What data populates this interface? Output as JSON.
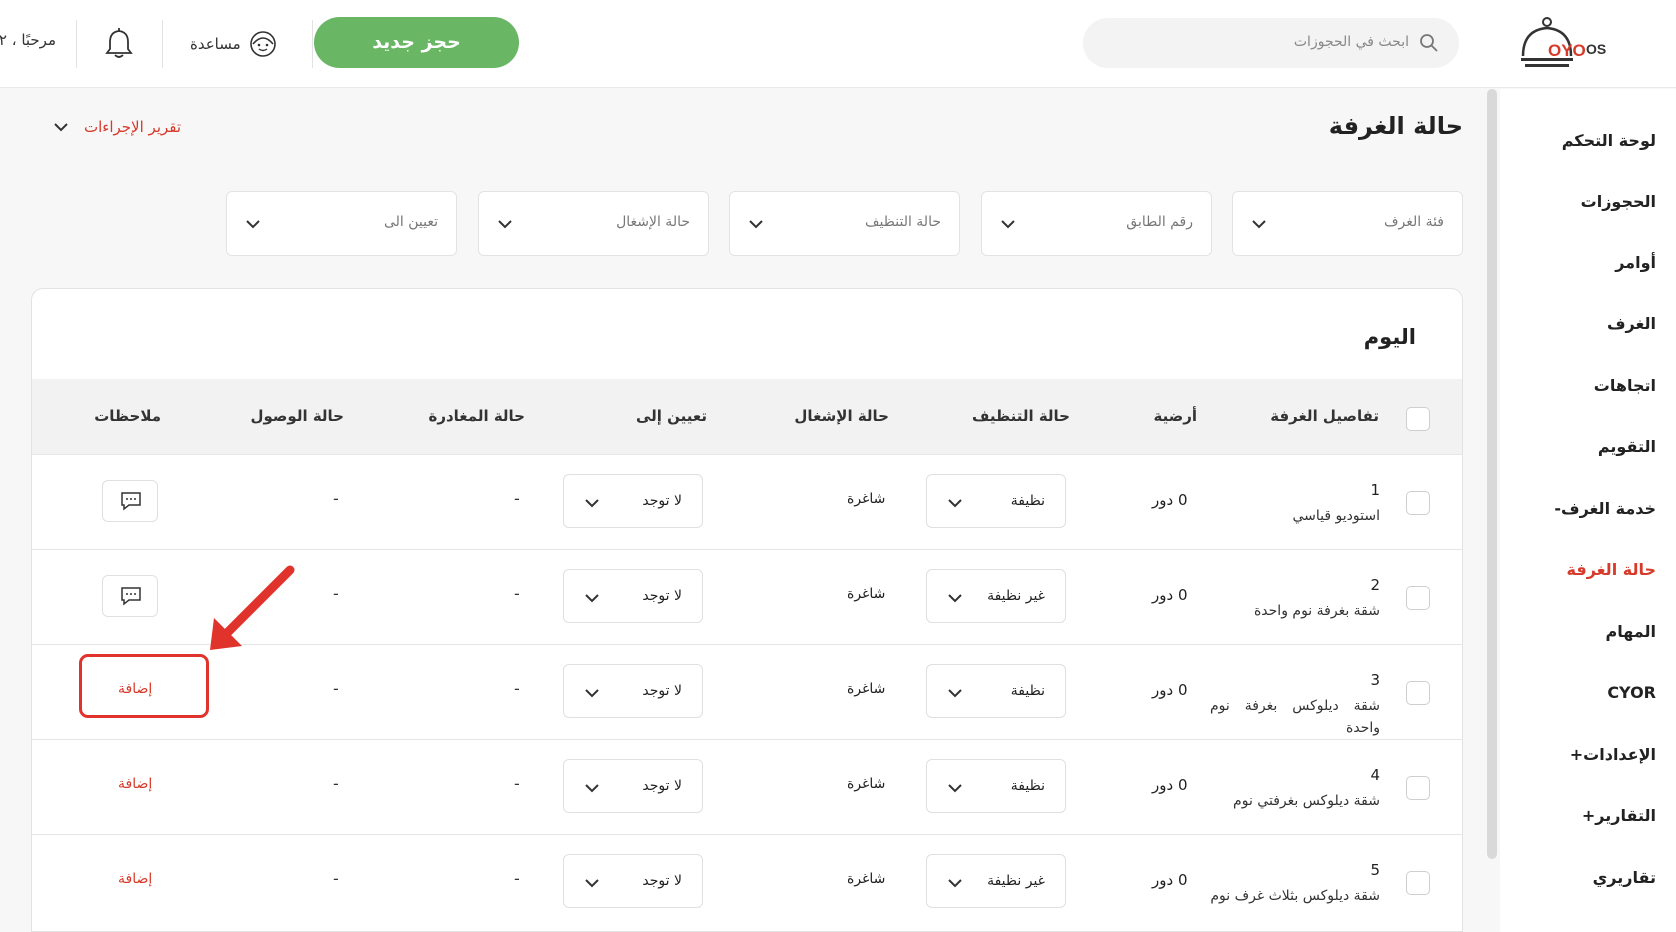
{
  "header": {
    "logo_text": "OYO OS",
    "search_placeholder": "ابحث في الحجوزات",
    "new_booking_label": "حجز جديد",
    "help_label": "مساعدة",
    "welcome_text": "مرحبًا ، ٢"
  },
  "sidebar": {
    "items": [
      {
        "label": "لوحة التحكم",
        "active": false
      },
      {
        "label": "الحجوزات",
        "active": false
      },
      {
        "label": "أوامر",
        "active": false
      },
      {
        "label": "الغرف",
        "active": false
      },
      {
        "label": "اتجاهات",
        "active": false
      },
      {
        "label": "التقويم",
        "active": false
      },
      {
        "label": "خدمة الغرف-",
        "active": false
      },
      {
        "label": "حالة الغرفة",
        "active": true
      },
      {
        "label": "المهام",
        "active": false
      },
      {
        "label": "CYOR",
        "active": false
      },
      {
        "label": "الإعدادات+",
        "active": false
      },
      {
        "label": "التقارير+",
        "active": false
      },
      {
        "label": "تقاريري",
        "active": false
      }
    ]
  },
  "page": {
    "title": "حالة الغرفة",
    "action_report_label": "تقرير الإجراءات"
  },
  "filters": [
    {
      "label": "فئة الغرف"
    },
    {
      "label": "رقم الطابق"
    },
    {
      "label": "حالة التنظيف"
    },
    {
      "label": "حالة الإشغال"
    },
    {
      "label": "تعيين الى"
    }
  ],
  "table": {
    "section_title": "اليوم",
    "columns": [
      "تفاصيل الغرفة",
      "أرضية",
      "حالة التنظيف",
      "حالة الإشغال",
      "تعيين إلى",
      "حالة المغادرة",
      "حالة الوصول",
      "ملاحظات"
    ],
    "rows": [
      {
        "number": "1",
        "type": "استوديو قياسي",
        "floor": "0 دور",
        "cleaning": "نظيفة",
        "occupancy": "شاغرة",
        "assign": "لا توجد",
        "departure": "-",
        "arrival": "-",
        "note": "comment",
        "note_label": ""
      },
      {
        "number": "2",
        "type": "شقة بغرفة نوم واحدة",
        "floor": "0 دور",
        "cleaning": "غير نظيفة",
        "occupancy": "شاغرة",
        "assign": "لا توجد",
        "departure": "-",
        "arrival": "-",
        "note": "comment",
        "note_label": ""
      },
      {
        "number": "3",
        "type": "شقة ديلوكس بغرفة نوم واحدة",
        "floor": "0 دور",
        "cleaning": "نظيفة",
        "occupancy": "شاغرة",
        "assign": "لا توجد",
        "departure": "-",
        "arrival": "-",
        "note": "add",
        "note_label": "إضافة"
      },
      {
        "number": "4",
        "type": "شقة ديلوكس بغرفتي نوم",
        "floor": "0 دور",
        "cleaning": "نظيفة",
        "occupancy": "شاغرة",
        "assign": "لا توجد",
        "departure": "-",
        "arrival": "-",
        "note": "add",
        "note_label": "إضافة"
      },
      {
        "number": "5",
        "type": "شقة ديلوكس بثلاث غرف نوم",
        "floor": "0 دور",
        "cleaning": "غير نظيفة",
        "occupancy": "شاغرة",
        "assign": "لا توجد",
        "departure": "-",
        "arrival": "-",
        "note": "add",
        "note_label": "إضافة"
      }
    ]
  },
  "colors": {
    "accent_red": "#d63a2a",
    "button_green": "#69b665",
    "annotation_red": "#e0332c"
  }
}
